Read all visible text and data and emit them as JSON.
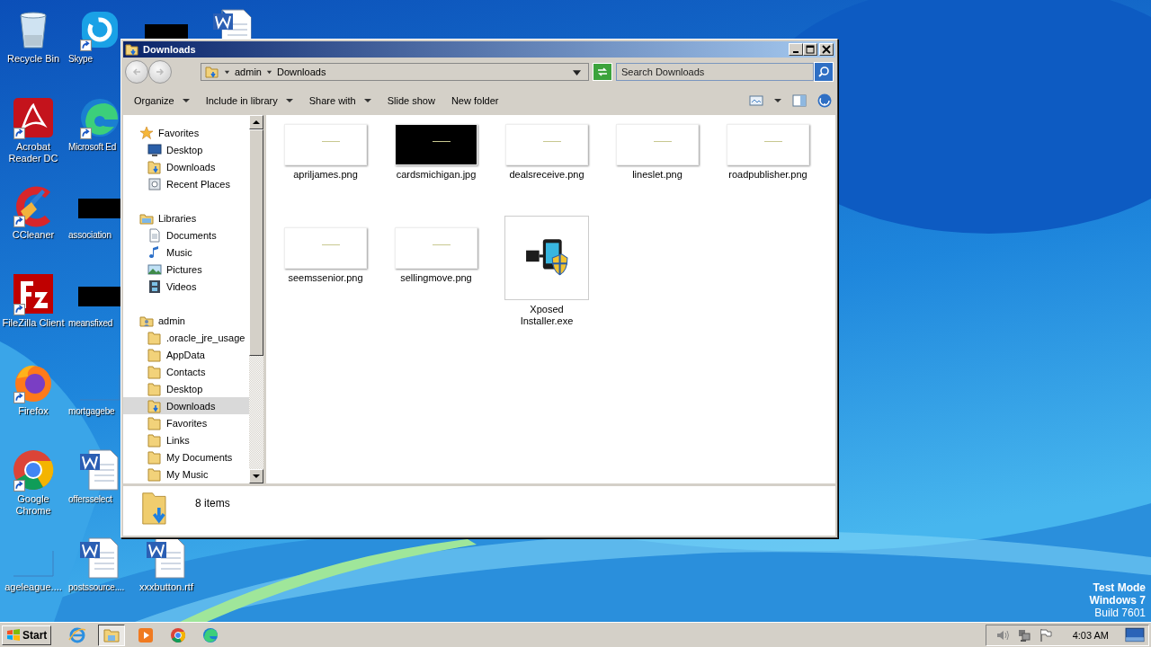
{
  "desktop": {
    "columns": [
      [
        {
          "label": "Recycle Bin",
          "kind": "recycle-bin",
          "shortcut": false
        },
        {
          "label": "Acrobat Reader DC",
          "kind": "acrobat",
          "shortcut": true
        },
        {
          "label": "CCleaner",
          "kind": "ccleaner",
          "shortcut": true
        },
        {
          "label": "FileZilla Client",
          "kind": "filezilla",
          "shortcut": true
        },
        {
          "label": "Firefox",
          "kind": "firefox",
          "shortcut": true
        },
        {
          "label": "Google Chrome",
          "kind": "chrome",
          "shortcut": true
        },
        {
          "label": "ageleague....",
          "kind": "blank-thumb",
          "shortcut": false
        }
      ],
      [
        {
          "label": "Skype",
          "kind": "skype",
          "shortcut": true
        },
        {
          "label": "Microsoft Ed",
          "kind": "edge",
          "shortcut": true
        },
        {
          "label": "association",
          "kind": "black-thumb",
          "shortcut": false
        },
        {
          "label": "meansfixed",
          "kind": "black-thumb",
          "shortcut": false
        },
        {
          "label": "mortgagebe",
          "kind": "blank-thumb",
          "shortcut": false
        },
        {
          "label": "offersselect",
          "kind": "word",
          "shortcut": false
        },
        {
          "label": "postssource....",
          "kind": "word",
          "shortcut": false
        }
      ],
      [
        {
          "kind": "black-thumb"
        },
        null,
        null,
        null,
        null,
        null,
        {
          "label": "xxxbutton.rtf",
          "kind": "word",
          "shortcut": false
        }
      ],
      [
        {
          "kind": "word"
        }
      ]
    ],
    "notice": [
      "Test Mode",
      "Windows 7",
      "Build 7601"
    ]
  },
  "window": {
    "title": "Downloads",
    "breadcrumb": [
      "admin",
      "Downloads"
    ],
    "search": {
      "placeholder": "Search Downloads"
    },
    "toolbar": [
      {
        "label": "Organize",
        "dropdown": true
      },
      {
        "label": "Include in library",
        "dropdown": true
      },
      {
        "label": "Share with",
        "dropdown": true
      },
      {
        "label": "Slide show",
        "dropdown": false
      },
      {
        "label": "New folder",
        "dropdown": false
      }
    ],
    "nav": [
      {
        "label": "Favorites",
        "kind": "star",
        "selected": false,
        "children": [
          {
            "label": "Desktop",
            "kind": "monitor",
            "selected": false
          },
          {
            "label": "Downloads",
            "kind": "download-folder",
            "selected": false
          },
          {
            "label": "Recent Places",
            "kind": "recent",
            "selected": false
          }
        ]
      },
      {
        "label": "Libraries",
        "kind": "library",
        "selected": false,
        "children": [
          {
            "label": "Documents",
            "kind": "document",
            "selected": false
          },
          {
            "label": "Music",
            "kind": "music",
            "selected": false
          },
          {
            "label": "Pictures",
            "kind": "pictures",
            "selected": false
          },
          {
            "label": "Videos",
            "kind": "videos",
            "selected": false
          }
        ]
      },
      {
        "label": "admin",
        "kind": "user",
        "selected": false,
        "children": [
          {
            "label": ".oracle_jre_usage",
            "kind": "folder",
            "selected": false
          },
          {
            "label": "AppData",
            "kind": "folder",
            "selected": false
          },
          {
            "label": "Contacts",
            "kind": "folder",
            "selected": false
          },
          {
            "label": "Desktop",
            "kind": "folder",
            "selected": false
          },
          {
            "label": "Downloads",
            "kind": "download-folder",
            "selected": true
          },
          {
            "label": "Favorites",
            "kind": "folder",
            "selected": false
          },
          {
            "label": "Links",
            "kind": "folder",
            "selected": false
          },
          {
            "label": "My Documents",
            "kind": "folder",
            "selected": false
          },
          {
            "label": "My Music",
            "kind": "folder",
            "selected": false
          }
        ]
      }
    ],
    "files": [
      {
        "name": "apriljames.png",
        "kind": "white-thumb"
      },
      {
        "name": "cardsmichigan.jpg",
        "kind": "black-thumb"
      },
      {
        "name": "dealsreceive.png",
        "kind": "white-thumb"
      },
      {
        "name": "lineslet.png",
        "kind": "white-thumb"
      },
      {
        "name": "roadpublisher.png",
        "kind": "white-thumb"
      },
      {
        "name": "seemssenior.png",
        "kind": "white-thumb"
      },
      {
        "name": "sellingmove.png",
        "kind": "white-thumb"
      },
      {
        "name": "Xposed Installer.exe",
        "kind": "exe"
      }
    ],
    "status": "8 items"
  },
  "taskbar": {
    "start": "Start",
    "apps": [
      {
        "kind": "ie",
        "selected": false
      },
      {
        "kind": "explorer",
        "selected": true
      },
      {
        "kind": "media",
        "selected": false
      },
      {
        "kind": "chrome",
        "selected": false
      },
      {
        "kind": "edge",
        "selected": false
      }
    ],
    "clock": "4:03 AM"
  }
}
